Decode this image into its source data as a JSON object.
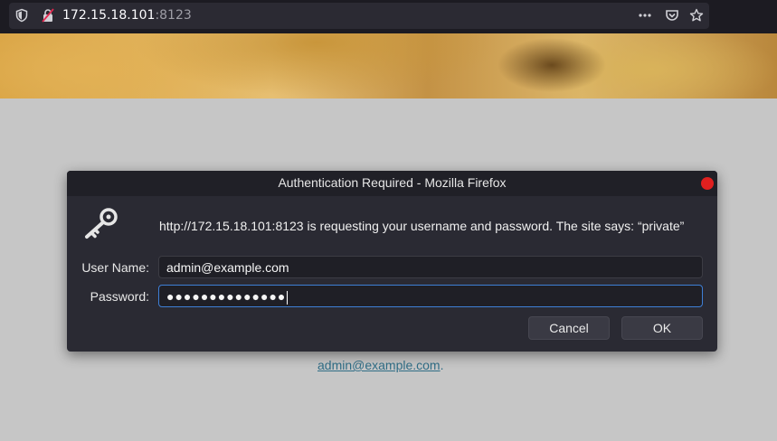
{
  "browser": {
    "url_host": "172.15.18.101",
    "url_port": ":8123"
  },
  "page": {
    "link_text": "admin@example.com",
    "link_suffix": "."
  },
  "dialog": {
    "title": "Authentication Required - Mozilla Firefox",
    "message": "http://172.15.18.101:8123 is requesting your username and password. The site says: “private”",
    "username_label": "User Name:",
    "username_value": "admin@example.com",
    "password_label": "Password:",
    "password_value": "●●●●●●●●●●●●●●",
    "cancel_label": "Cancel",
    "ok_label": "OK"
  },
  "colors": {
    "dialog_bg": "#2a2a33",
    "focus_border": "#3e7fd6",
    "close_button": "#e0201f"
  }
}
